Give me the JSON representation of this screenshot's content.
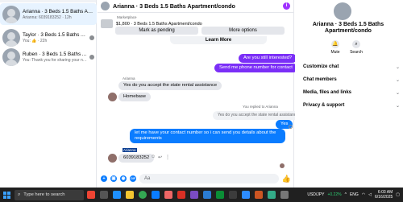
{
  "conversations": [
    {
      "name": "Arianna · 3 Beds 1.5 Baths Apartment...",
      "preview": "Arianna: 6039183252 · 12h",
      "active": true
    },
    {
      "name": "Taylor · 3 Beds 1.5 Baths Apartment/...",
      "preview": "You: 👍 · 22h",
      "active": false
    },
    {
      "name": "Ruben · 3 Beds 1.5 Baths Apartment/...",
      "preview": "You: Thank you for sharing your nu... · 1d",
      "active": false
    }
  ],
  "chat": {
    "title": "Arianna · 3 Beds 1.5 Baths Apartment/condo",
    "marketplace_label": "Marketplace",
    "listing": "$1,800 · 3 Beds 1.5 Baths Apartment/condo",
    "mark_pending": "Mark as pending",
    "more_options": "More options",
    "learn_more": "Learn More",
    "msg_interested": "Are you still interested?",
    "msg_send_phone": "Send me phone number for contact",
    "sender_name": "Arianna",
    "msg_state_rental": "Yes do you accept the state rental assistance",
    "msg_homebase": "Homebase",
    "reply_tag": "You replied to Arianna",
    "msg_quoted": "Yes do you accept the state rental assistance",
    "msg_yes": "Yes",
    "msg_contact_1": "let me have your contact number so i can send you details about the",
    "msg_contact_2": "requirements",
    "sender_name_2": "Arianna",
    "msg_phone": "6039183252",
    "composer_placeholder": "Aa"
  },
  "details": {
    "name_line1": "Arianna · 3 Beds 1.5 Baths",
    "name_line2": "Apartment/condo",
    "mute": "Mute",
    "search": "Search",
    "sections": [
      "Customize chat",
      "Chat members",
      "Media, files and links",
      "Privacy & support"
    ]
  },
  "taskbar": {
    "search_placeholder": "Type here to search",
    "ticker": "USD/JPY",
    "ticker_change": "+0.22%",
    "lang": "ENG",
    "time": "6:03 AM",
    "date": "6/16/2025"
  },
  "colors": {
    "accent": "#0a7cff",
    "purple": "#7b2ff7",
    "taskbar": "#202020"
  }
}
